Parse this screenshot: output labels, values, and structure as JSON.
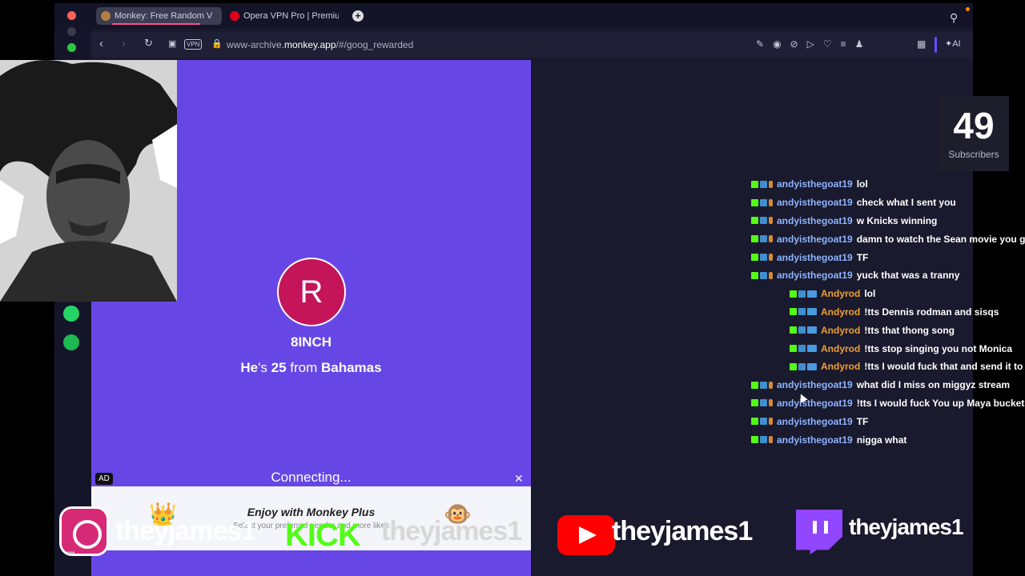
{
  "browser": {
    "tabs": [
      {
        "label": "Monkey: Free Random V",
        "active": true
      },
      {
        "label": "Opera VPN Pro | Premiur",
        "active": false
      }
    ],
    "vpn_label": "VPN",
    "url_prefix": "www-archive.",
    "url_domain": "monkey.app",
    "url_suffix": "/#/goog_rewarded",
    "ai_label": "AI"
  },
  "monkey": {
    "avatar_letter": "R",
    "username": "8INCH",
    "pronoun": "He",
    "age_text": "'s ",
    "age": "25",
    "from_text": " from ",
    "location": "Bahamas",
    "status": "Connecting...",
    "ad_label": "AD",
    "ad_title": "Enjoy with Monkey Plus",
    "ad_subtitle": "Select your preferred gender and more likes"
  },
  "stream": {
    "subscriber_count": "49",
    "subscriber_label": "Subscribers",
    "chat": [
      {
        "user": "andyisthegoat19",
        "text": "lol",
        "reply": false
      },
      {
        "user": "andyisthegoat19",
        "text": "check what I sent you",
        "reply": false
      },
      {
        "user": "andyisthegoat19",
        "text": "w Knicks winning",
        "reply": false
      },
      {
        "user": "andyisthegoat19",
        "text": "damn to watch the Sean movie you go",
        "reply": false
      },
      {
        "user": "andyisthegoat19",
        "text": "TF",
        "reply": false
      },
      {
        "user": "andyisthegoat19",
        "text": "yuck that was a tranny",
        "reply": false
      },
      {
        "user": "Andyrod",
        "text": "lol",
        "reply": true
      },
      {
        "user": "Andyrod",
        "text": "!tts Dennis rodman and sisqs",
        "reply": true
      },
      {
        "user": "Andyrod",
        "text": "!tts that thong song",
        "reply": true
      },
      {
        "user": "Andyrod",
        "text": "!tts stop singing you not Monica",
        "reply": true
      },
      {
        "user": "Andyrod",
        "text": "!tts I would fuck that and send it to yo",
        "reply": true
      },
      {
        "user": "andyisthegoat19",
        "text": "what did I miss on miggyz stream",
        "reply": false
      },
      {
        "user": "andyisthegoat19",
        "text": "!tts I would fuck You up Maya buckets",
        "reply": false
      },
      {
        "user": "andyisthegoat19",
        "text": "TF",
        "reply": false
      },
      {
        "user": "andyisthegoat19",
        "text": "nigga what",
        "reply": false
      }
    ],
    "socials": {
      "instagram_handle": "theyjames1",
      "kick_word": "KICK",
      "kick_handle": "theyjames1",
      "youtube_handle": "theyjames1",
      "twitch_handle": "theyjames1"
    }
  },
  "colors": {
    "monkey_bg": "#6647e6",
    "avatar_bg": "#c4145a",
    "kick_green": "#53fc18",
    "youtube_red": "#ff0000",
    "twitch_purple": "#9146ff"
  }
}
